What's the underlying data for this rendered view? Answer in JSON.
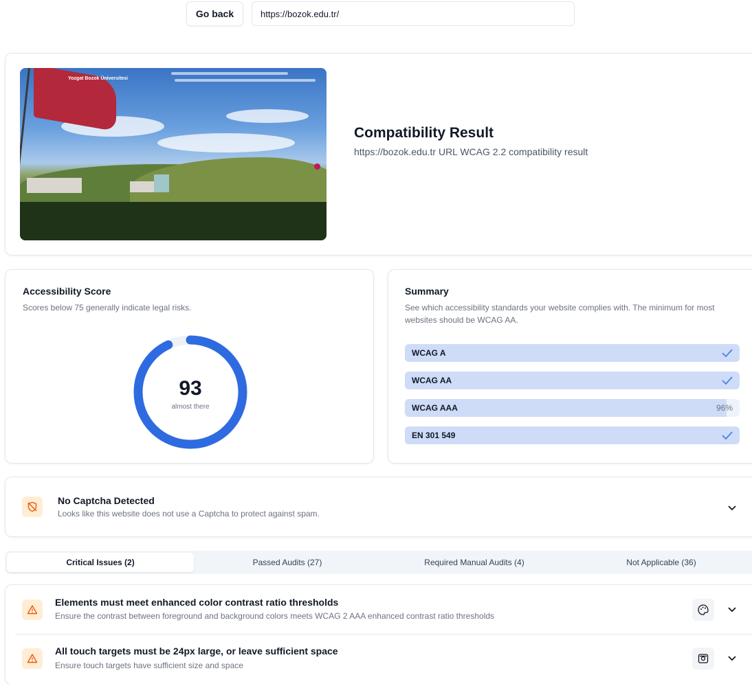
{
  "topbar": {
    "back_label": "Go back",
    "url_value": "https://bozok.edu.tr/"
  },
  "hero": {
    "screenshot_brand": "Yozgat Bozok Üniversitesi",
    "title": "Compatibility Result",
    "subtitle": "https://bozok.edu.tr URL WCAG 2.2 compatibility result"
  },
  "score": {
    "title": "Accessibility Score",
    "description": "Scores below 75 generally indicate legal risks.",
    "value": "93",
    "value_num": 93,
    "label": "almost there",
    "accent": "#2f6be0"
  },
  "summary": {
    "title": "Summary",
    "description": "See which accessibility standards your website complies with. The minimum for most websites should be WCAG AA.",
    "standards": [
      {
        "name": "WCAG A",
        "status": "check",
        "percent": 100
      },
      {
        "name": "WCAG AA",
        "status": "check",
        "percent": 100
      },
      {
        "name": "WCAG AAA",
        "status": "96%",
        "percent": 96
      },
      {
        "name": "EN 301 549",
        "status": "check",
        "percent": 100
      }
    ]
  },
  "captcha": {
    "icon": "shield-off-icon",
    "title": "No Captcha Detected",
    "description": "Looks like this website does not use a Captcha to protect against spam."
  },
  "tabs": [
    {
      "label": "Critical Issues (2)",
      "active": true
    },
    {
      "label": "Passed Audits (27)",
      "active": false
    },
    {
      "label": "Required Manual Audits (4)",
      "active": false
    },
    {
      "label": "Not Applicable (36)",
      "active": false
    }
  ],
  "issues": [
    {
      "title": "Elements must meet enhanced color contrast ratio thresholds",
      "description": "Ensure the contrast between foreground and background colors meets WCAG 2 AAA enhanced contrast ratio thresholds",
      "tool_icon": "palette-icon"
    },
    {
      "title": "All touch targets must be 24px large, or leave sufficient space",
      "description": "Ensure touch targets have sufficient size and space",
      "tool_icon": "touch-target-icon"
    }
  ],
  "colors": {
    "warning_bg": "#ffedd5",
    "warning_fg": "#ea580c",
    "progress_bg": "#eef3fb",
    "progress_fill": "#cfdcf7",
    "check": "#4f7ee8"
  }
}
